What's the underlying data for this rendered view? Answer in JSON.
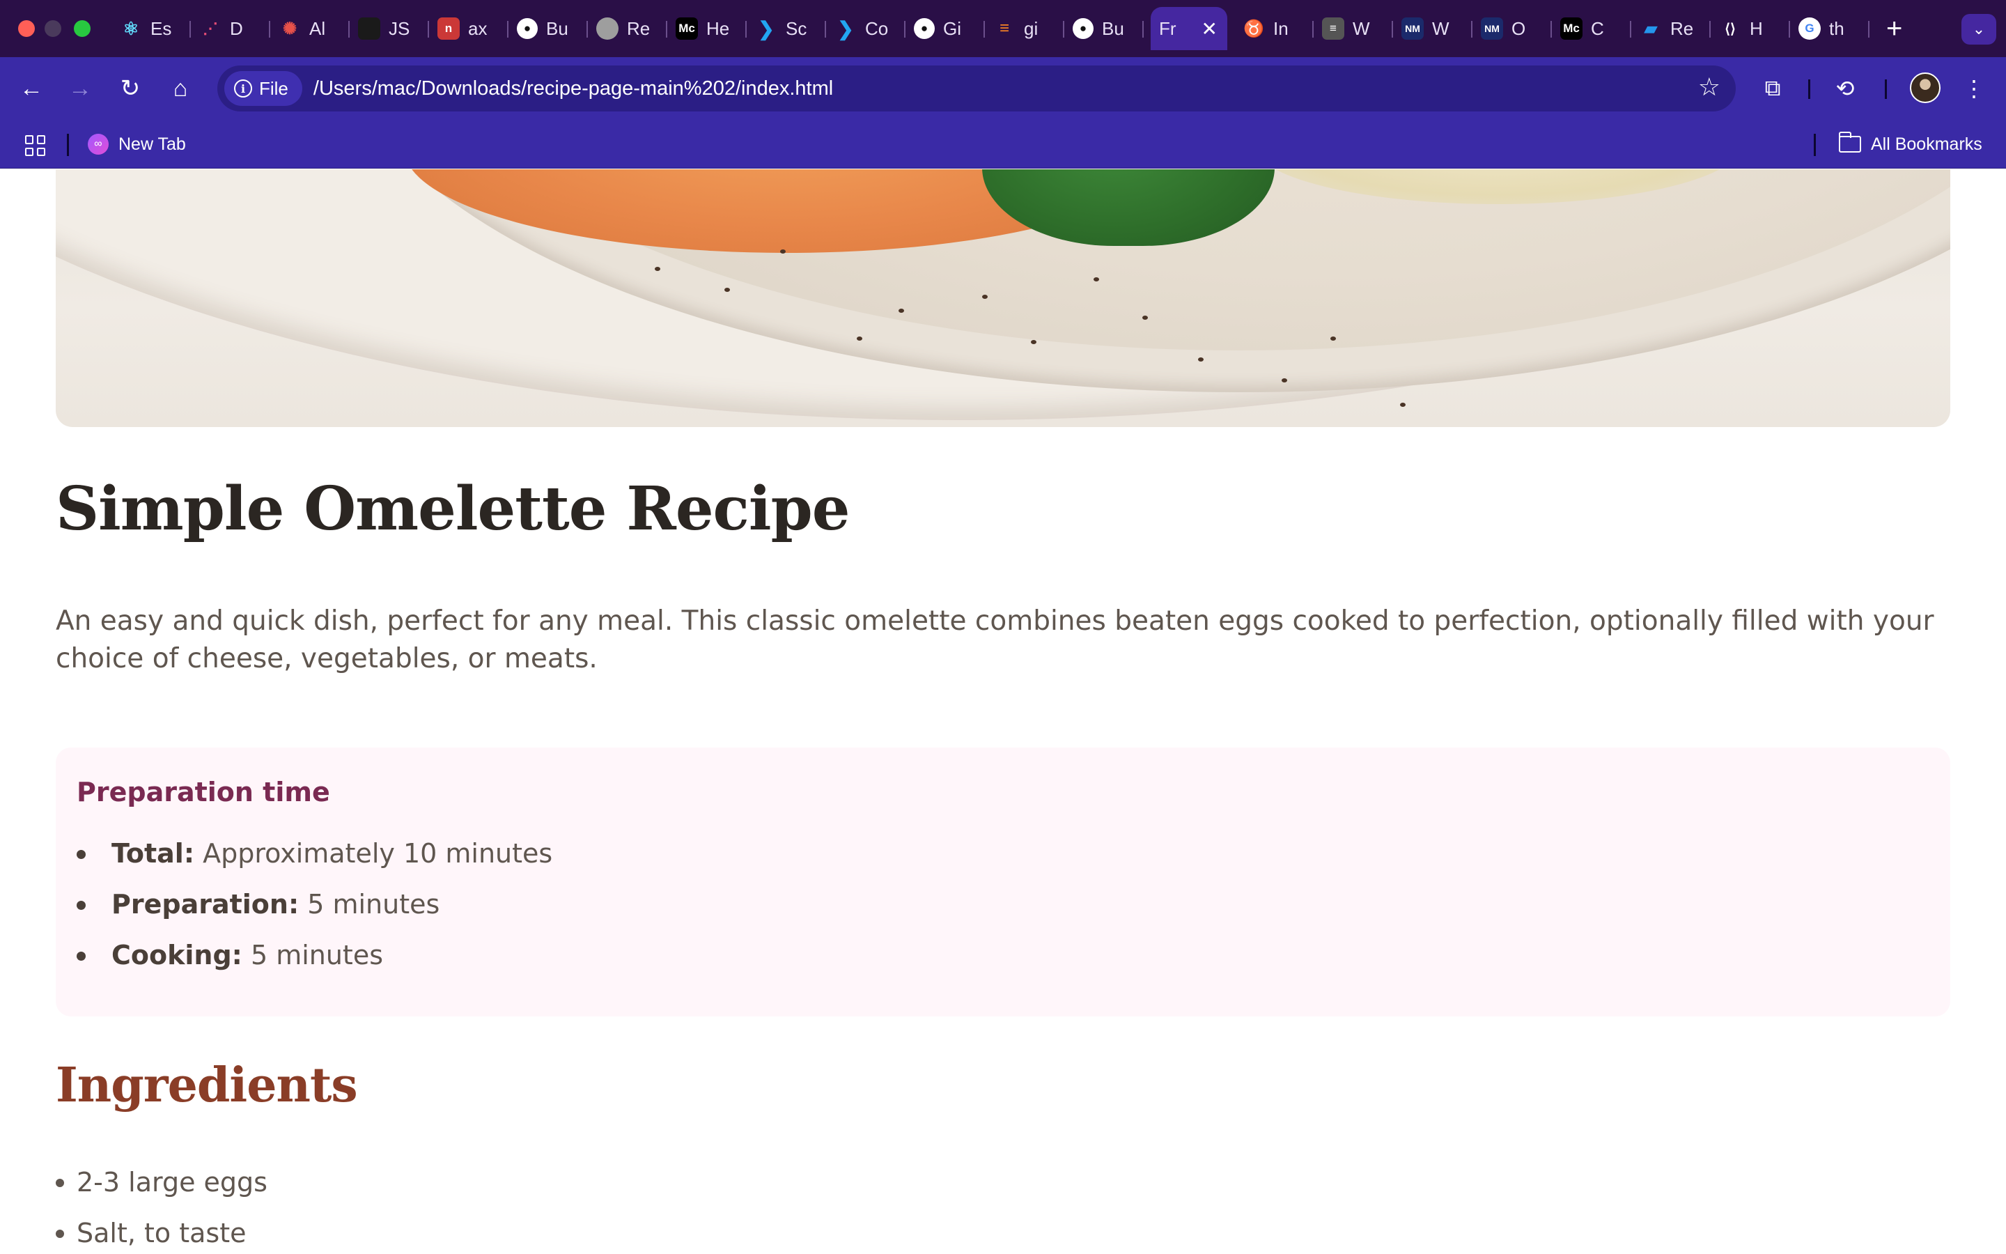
{
  "browser": {
    "tabs": [
      {
        "label": "Es",
        "icon": "react-icon",
        "color": "#61dafb"
      },
      {
        "label": "D",
        "icon": "analytics-icon",
        "color": "#e94e77"
      },
      {
        "label": "Al",
        "icon": "octopus-icon",
        "color": "#e8524a"
      },
      {
        "label": "JS",
        "icon": "js-icon",
        "color": "#222222"
      },
      {
        "label": "ax",
        "icon": "npm-icon",
        "color": "#cb3837"
      },
      {
        "label": "Bu",
        "icon": "github-icon",
        "color": "#ffffff"
      },
      {
        "label": "Re",
        "icon": "avatar-icon",
        "color": "#9e9e9e"
      },
      {
        "label": "He",
        "icon": "medium-icon",
        "color": "#000000"
      },
      {
        "label": "Sc",
        "icon": "vscode-icon",
        "color": "#22a6f2"
      },
      {
        "label": "Co",
        "icon": "vscode-icon",
        "color": "#22a6f2"
      },
      {
        "label": "Gi",
        "icon": "github-icon",
        "color": "#ffffff"
      },
      {
        "label": "gi",
        "icon": "stackoverflow-icon",
        "color": "#f48024"
      },
      {
        "label": "Bu",
        "icon": "github-icon",
        "color": "#ffffff"
      }
    ],
    "active_tab": {
      "label": "Fr",
      "close": "✕"
    },
    "tabs_after": [
      {
        "label": "In",
        "icon": "bull-icon",
        "color": "#f0c36b"
      },
      {
        "label": "W",
        "icon": "notes-icon",
        "color": "#555555"
      },
      {
        "label": "W",
        "icon": "nm-icon",
        "color": "#1b2a6b"
      },
      {
        "label": "O",
        "icon": "nm-icon",
        "color": "#1b2a6b"
      },
      {
        "label": "C",
        "icon": "medium-icon",
        "color": "#000000"
      },
      {
        "label": "Re",
        "icon": "docker-icon",
        "color": "#2496ed"
      },
      {
        "label": "H",
        "icon": "astro-icon",
        "color": "#2a0f47"
      },
      {
        "label": "th",
        "icon": "google-icon",
        "color": "#ffffff"
      }
    ],
    "fav_text": {
      "medium": "Mc",
      "nm": "NM"
    },
    "new_tab": "+",
    "url_chip": "File",
    "url": "/Users/mac/Downloads/recipe-page-main%202/index.html",
    "bookmark": "New Tab",
    "all_bookmarks": "All Bookmarks",
    "colors": {
      "tab_strip": "#2a0f47",
      "toolbar": "#3a2aa6",
      "active_tab": "#4527a0"
    }
  },
  "page": {
    "title": "Simple Omelette Recipe",
    "intro": "An easy and quick dish, perfect for any meal. This classic omelette combines beaten eggs cooked to perfection, optionally filled with your choice of cheese, vegetables, or meats.",
    "prep": {
      "heading": "Preparation time",
      "items": [
        {
          "label": "Total:",
          "value": " Approximately 10 minutes"
        },
        {
          "label": "Preparation:",
          "value": " 5 minutes"
        },
        {
          "label": "Cooking:",
          "value": " 5 minutes"
        }
      ]
    },
    "ingredients": {
      "heading": "Ingredients",
      "items": [
        "2-3 large eggs",
        "Salt, to taste"
      ]
    },
    "colors": {
      "title": "#2b2622",
      "prep_bg": "#fff6fa",
      "prep_heading": "#7a2a52",
      "ingredients_heading": "#8a3d27",
      "body_text": "#5f564f"
    }
  }
}
